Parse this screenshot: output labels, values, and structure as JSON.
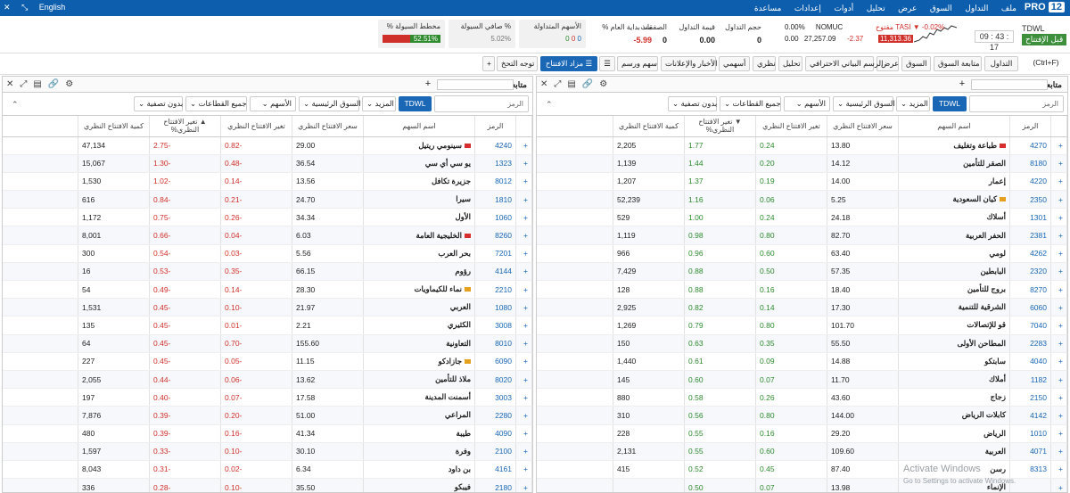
{
  "topbar": {
    "brand": "PRO",
    "brand_num": "12",
    "menu": [
      "ملف",
      "التداول",
      "السوق",
      "عرض",
      "تحليل",
      "أدوات",
      "إعدادات",
      "مساعدة"
    ],
    "language": "English",
    "window_icons": [
      "close-icon",
      "collapse-icon",
      "expand-icon"
    ]
  },
  "header": {
    "clock": "09 : 43 : 17",
    "market": "TDWL",
    "phase": "قبل الإفتتاح",
    "tasi": {
      "label": "TASI",
      "change_pct": "-0.02%",
      "state": "مفتوح",
      "change": "-2.37",
      "value": "11,313.36"
    },
    "nomuc": {
      "label": "NOMUC",
      "change_pct": "0.00%",
      "change": "0.00",
      "value": "27,257.09"
    },
    "stats": [
      {
        "label": "حجم التداول",
        "value": "0",
        "color": "#222"
      },
      {
        "label": "قيمة التداول",
        "value": "0.00",
        "color": "#222"
      },
      {
        "label": "الصفقات",
        "value": "0",
        "color": "#222"
      },
      {
        "label": "% منذ بداية العام",
        "value": "-5.99",
        "color": "#d0302a"
      }
    ],
    "cards": [
      {
        "label": "الأسهم المتداولة",
        "value": [
          "0",
          "0",
          "0"
        ]
      },
      {
        "label": "صافي السيولة %",
        "value": "5.02%"
      },
      {
        "label": "% مخطط السيولة",
        "value": "52.51%"
      }
    ]
  },
  "toolbar": {
    "items": [
      "(Ctrl+F)",
      "التداول",
      "متابعة السوق",
      "السوق",
      "عرض",
      "الرسم البياني الاحترافي",
      "تحليل",
      "نظري",
      "أسهمي",
      "الأخبار والإعلانات",
      "سهم ورسم",
      "مزاد الافتتاح",
      "توجه التحخ"
    ],
    "add": "+"
  },
  "panel_left": {
    "title": "متابعة السوق : بث الب...",
    "search_placeholder": "الرمز",
    "filters": [
      "TDWL",
      "المزيد",
      "السوق الرئيسية",
      "الأسهم",
      "جميع القطاعات",
      "بدون تصفية"
    ],
    "columns": [
      "الرمز",
      "اسم السهم",
      "سعر الافتتاح النظري",
      "تغير الافتتاح النظري",
      "تغير الافتتاح النظري%",
      "كمية الافتتاح النظري"
    ],
    "rows": [
      {
        "symbol": "4270",
        "name": "طباعة وتغليف",
        "price": "13.80",
        "chg": "0.24",
        "pct": "1.77",
        "qty": "2,205",
        "flag": "r"
      },
      {
        "symbol": "8180",
        "name": "الصقر للتأمين",
        "price": "14.12",
        "chg": "0.20",
        "pct": "1.44",
        "qty": "1,139",
        "flag": ""
      },
      {
        "symbol": "4220",
        "name": "إعمار",
        "price": "14.00",
        "chg": "0.19",
        "pct": "1.37",
        "qty": "1,207",
        "flag": ""
      },
      {
        "symbol": "2350",
        "name": "كيان السعودية",
        "price": "5.25",
        "chg": "0.06",
        "pct": "1.16",
        "qty": "52,239",
        "flag": "o"
      },
      {
        "symbol": "1301",
        "name": "أسلاك",
        "price": "24.18",
        "chg": "0.24",
        "pct": "1.00",
        "qty": "529",
        "flag": ""
      },
      {
        "symbol": "2381",
        "name": "الحفر العربية",
        "price": "82.70",
        "chg": "0.80",
        "pct": "0.98",
        "qty": "1,119",
        "flag": ""
      },
      {
        "symbol": "4262",
        "name": "لومي",
        "price": "63.40",
        "chg": "0.60",
        "pct": "0.96",
        "qty": "966",
        "flag": ""
      },
      {
        "symbol": "2320",
        "name": "البابطين",
        "price": "57.35",
        "chg": "0.50",
        "pct": "0.88",
        "qty": "7,429",
        "flag": ""
      },
      {
        "symbol": "8270",
        "name": "بروج للتأمين",
        "price": "18.40",
        "chg": "0.16",
        "pct": "0.88",
        "qty": "128",
        "flag": ""
      },
      {
        "symbol": "6060",
        "name": "الشرقية للتنمية",
        "price": "17.30",
        "chg": "0.14",
        "pct": "0.82",
        "qty": "2,925",
        "flag": ""
      },
      {
        "symbol": "7040",
        "name": "قو للإتصالات",
        "price": "101.70",
        "chg": "0.80",
        "pct": "0.79",
        "qty": "1,269",
        "flag": ""
      },
      {
        "symbol": "2283",
        "name": "المطاحن الأولى",
        "price": "55.50",
        "chg": "0.35",
        "pct": "0.63",
        "qty": "150",
        "flag": ""
      },
      {
        "symbol": "4040",
        "name": "سابتكو",
        "price": "14.88",
        "chg": "0.09",
        "pct": "0.61",
        "qty": "1,440",
        "flag": ""
      },
      {
        "symbol": "1182",
        "name": "أملاك",
        "price": "11.70",
        "chg": "0.07",
        "pct": "0.60",
        "qty": "145",
        "flag": ""
      },
      {
        "symbol": "2150",
        "name": "زجاج",
        "price": "43.60",
        "chg": "0.26",
        "pct": "0.58",
        "qty": "880",
        "flag": ""
      },
      {
        "symbol": "4142",
        "name": "كابلات الرياض",
        "price": "144.00",
        "chg": "0.80",
        "pct": "0.56",
        "qty": "310",
        "flag": ""
      },
      {
        "symbol": "1010",
        "name": "الرياض",
        "price": "29.20",
        "chg": "0.16",
        "pct": "0.55",
        "qty": "228",
        "flag": ""
      },
      {
        "symbol": "4071",
        "name": "العربية",
        "price": "109.60",
        "chg": "0.60",
        "pct": "0.55",
        "qty": "2,131",
        "flag": ""
      },
      {
        "symbol": "8313",
        "name": "رسن",
        "price": "87.40",
        "chg": "0.45",
        "pct": "0.52",
        "qty": "415",
        "flag": ""
      },
      {
        "symbol": "",
        "name": "الإنماء",
        "price": "13.98",
        "chg": "0.07",
        "pct": "0.50",
        "qty": "",
        "flag": ""
      }
    ]
  },
  "panel_right": {
    "title": "متابعة السوق : بث الب...",
    "search_placeholder": "الرمز",
    "filters": [
      "TDWL",
      "المزيد",
      "السوق الرئيسية",
      "الأسهم",
      "جميع القطاعات",
      "بدون تصفية"
    ],
    "columns": [
      "الرمز",
      "اسم السهم",
      "سعر الافتتاح النظري",
      "تغير الافتتاح النظري",
      "تغير الافتتاح النظري%",
      "كمية الافتتاح النظري"
    ],
    "rows": [
      {
        "symbol": "4240",
        "name": "سينومي ريتيل",
        "price": "29.00",
        "chg": "-0.82",
        "pct": "-2.75",
        "qty": "47,134",
        "flag": "r"
      },
      {
        "symbol": "1323",
        "name": "يو سي أي سي",
        "price": "36.54",
        "chg": "-0.48",
        "pct": "-1.30",
        "qty": "15,067",
        "flag": ""
      },
      {
        "symbol": "8012",
        "name": "جزيرة تكافل",
        "price": "13.56",
        "chg": "-0.14",
        "pct": "-1.02",
        "qty": "1,530",
        "flag": ""
      },
      {
        "symbol": "1810",
        "name": "سيرا",
        "price": "24.70",
        "chg": "-0.21",
        "pct": "-0.84",
        "qty": "616",
        "flag": ""
      },
      {
        "symbol": "1060",
        "name": "الأول",
        "price": "34.34",
        "chg": "-0.26",
        "pct": "-0.75",
        "qty": "1,172",
        "flag": ""
      },
      {
        "symbol": "8260",
        "name": "الخليجية العامة",
        "price": "6.03",
        "chg": "-0.04",
        "pct": "-0.66",
        "qty": "8,001",
        "flag": "r"
      },
      {
        "symbol": "7201",
        "name": "بحر العرب",
        "price": "5.56",
        "chg": "-0.03",
        "pct": "-0.54",
        "qty": "300",
        "flag": ""
      },
      {
        "symbol": "4144",
        "name": "رؤوم",
        "price": "66.15",
        "chg": "-0.35",
        "pct": "-0.53",
        "qty": "16",
        "flag": ""
      },
      {
        "symbol": "2210",
        "name": "نماء للكيماويات",
        "price": "28.30",
        "chg": "-0.14",
        "pct": "-0.49",
        "qty": "54",
        "flag": "o"
      },
      {
        "symbol": "1080",
        "name": "العربي",
        "price": "21.97",
        "chg": "-0.10",
        "pct": "-0.45",
        "qty": "1,531",
        "flag": ""
      },
      {
        "symbol": "3008",
        "name": "الكثيري",
        "price": "2.21",
        "chg": "-0.01",
        "pct": "-0.45",
        "qty": "135",
        "flag": ""
      },
      {
        "symbol": "8010",
        "name": "التعاونية",
        "price": "155.60",
        "chg": "-0.70",
        "pct": "-0.45",
        "qty": "64",
        "flag": ""
      },
      {
        "symbol": "6090",
        "name": "جازادكو",
        "price": "11.15",
        "chg": "-0.05",
        "pct": "-0.45",
        "qty": "227",
        "flag": "o"
      },
      {
        "symbol": "8020",
        "name": "ملاذ للتأمين",
        "price": "13.62",
        "chg": "-0.06",
        "pct": "-0.44",
        "qty": "2,055",
        "flag": ""
      },
      {
        "symbol": "3003",
        "name": "أسمنت المدينة",
        "price": "17.58",
        "chg": "-0.07",
        "pct": "-0.40",
        "qty": "197",
        "flag": ""
      },
      {
        "symbol": "2280",
        "name": "المراعي",
        "price": "51.00",
        "chg": "-0.20",
        "pct": "-0.39",
        "qty": "7,876",
        "flag": ""
      },
      {
        "symbol": "4090",
        "name": "طيبة",
        "price": "41.34",
        "chg": "-0.16",
        "pct": "-0.39",
        "qty": "480",
        "flag": ""
      },
      {
        "symbol": "2100",
        "name": "وفرة",
        "price": "30.10",
        "chg": "-0.10",
        "pct": "-0.33",
        "qty": "1,597",
        "flag": ""
      },
      {
        "symbol": "4161",
        "name": "بن داود",
        "price": "6.34",
        "chg": "-0.02",
        "pct": "-0.31",
        "qty": "8,043",
        "flag": ""
      },
      {
        "symbol": "2180",
        "name": "فيبكو",
        "price": "35.50",
        "chg": "-0.10",
        "pct": "-0.28",
        "qty": "336",
        "flag": ""
      }
    ]
  },
  "watermark": {
    "line1": "Activate Windows",
    "line2": "Go to Settings to activate Windows."
  }
}
